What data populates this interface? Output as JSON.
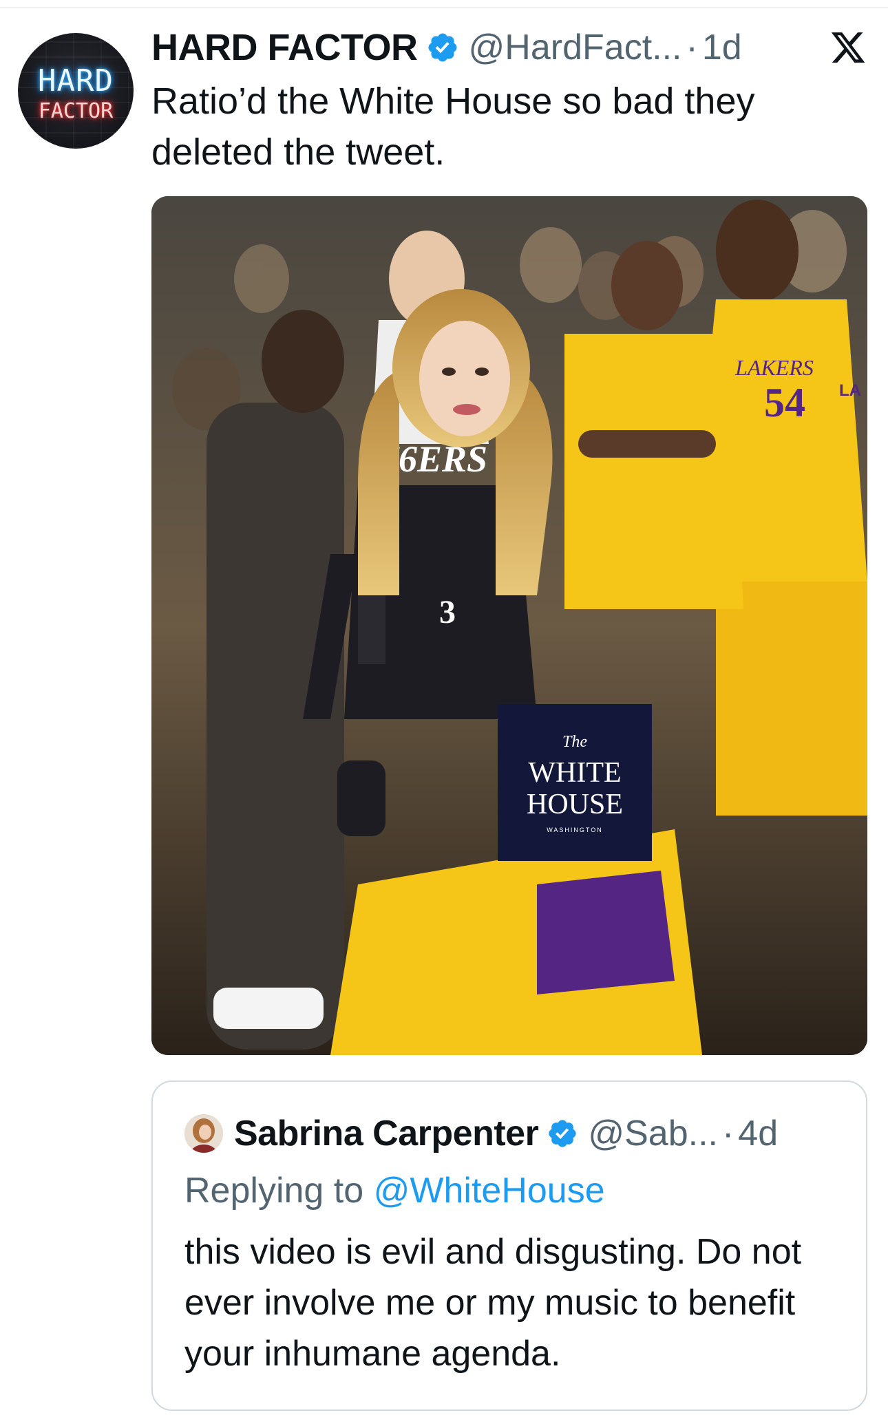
{
  "tweet": {
    "avatar": {
      "text_top": "HARD",
      "text_bottom": "FACTOR"
    },
    "author_name": "HARD FACTOR",
    "handle": "@HardFact...",
    "separator": "·",
    "time": "1d",
    "text": "Ratio’d the White House so bad they deleted the tweet.",
    "platform_icon": "x-logo-icon",
    "verified_icon": "verified-badge-icon",
    "media": {
      "jersey_team": "76ERS",
      "jersey_number": "3",
      "lakers_jersey_text": "LAKERS",
      "lakers_number": "54",
      "lakers_sleeve": "LA",
      "overlay": {
        "the": "The",
        "line1": "WHITE",
        "line2": "HOUSE",
        "sub": "WASHINGTON"
      }
    }
  },
  "quoted_tweet": {
    "author_name": "Sabrina Carpenter",
    "handle": "@Sab...",
    "separator": "·",
    "time": "4d",
    "reply_prefix": "Replying to ",
    "reply_mention": "@WhiteHouse",
    "text": "this video is evil and disgusting. Do not ever involve me or my music to benefit your inhumane agenda."
  },
  "colors": {
    "text_primary": "#0f1419",
    "text_secondary": "#536471",
    "link_blue": "#1d9bf0",
    "verified_blue": "#1d9bf0",
    "border": "#cfd9de",
    "lakers_gold": "#f5c518",
    "lakers_purple": "#552583",
    "white_house_navy": "#13183a"
  }
}
